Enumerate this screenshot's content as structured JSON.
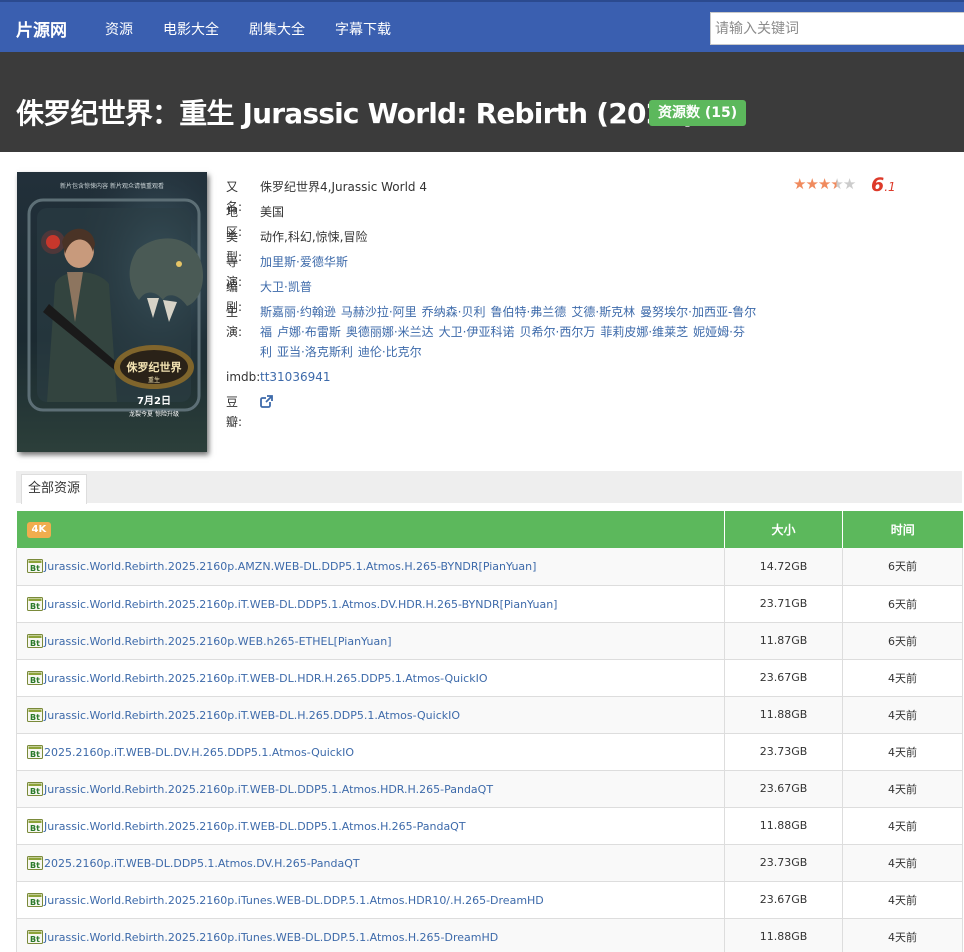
{
  "nav": {
    "brand": "片源网",
    "items": [
      "资源",
      "电影大全",
      "剧集大全",
      "字幕下载"
    ],
    "search_placeholder": "请输入关键词"
  },
  "movie": {
    "title": "侏罗纪世界：重生 Jurassic World: Rebirth (2025)",
    "resource_badge": "资源数 (15)",
    "poster": {
      "top_text": "新片包含惊悚内容  新片观众请慎重观看",
      "logo_title": "侏罗纪世界",
      "logo_sub": "重生",
      "release": "7月2日",
      "tagline": "龙裂今夏 惊险升级"
    },
    "rating": {
      "stars": 3.5,
      "score_big": "6",
      "score_small": ".1"
    },
    "labels": {
      "aka": "又名:",
      "region": "地区:",
      "genre": "类型:",
      "director": "导演:",
      "writer": "编剧:",
      "cast": "主演:",
      "imdb": "imdb:",
      "douban": "豆瓣:"
    },
    "aka": "侏罗纪世界4,Jurassic World 4",
    "region": "美国",
    "genre": "动作,科幻,惊悚,冒险",
    "director": "加里斯·爱德华斯",
    "writer": "大卫·凯普",
    "cast": [
      "斯嘉丽·约翰逊",
      "马赫沙拉·阿里",
      "乔纳森·贝利",
      "鲁伯特·弗兰德",
      "艾德·斯克林",
      "曼努埃尔·加西亚-鲁尔福",
      "卢娜·布雷斯",
      "奥德丽娜·米兰达",
      "大卫·伊亚科诺",
      "贝希尔·西尔万",
      "菲莉皮娜·维莱芝",
      "妮娅姆·芬利",
      "亚当·洛克斯利",
      "迪伦·比克尔"
    ],
    "imdb": "tt31036941"
  },
  "tabs": {
    "active": "全部资源"
  },
  "table": {
    "quality_badge": "4K",
    "col_size": "大小",
    "col_time": "时间",
    "rows": [
      {
        "name": "Jurassic.World.Rebirth.2025.2160p.AMZN.WEB-DL.DDP5.1.Atmos.H.265-BYNDR[PianYuan]",
        "size": "14.72GB",
        "time": "6天前"
      },
      {
        "name": "Jurassic.World.Rebirth.2025.2160p.iT.WEB-DL.DDP5.1.Atmos.DV.HDR.H.265-BYNDR[PianYuan]",
        "size": "23.71GB",
        "time": "6天前"
      },
      {
        "name": "Jurassic.World.Rebirth.2025.2160p.WEB.h265-ETHEL[PianYuan]",
        "size": "11.87GB",
        "time": "6天前"
      },
      {
        "name": "Jurassic.World.Rebirth.2025.2160p.iT.WEB-DL.HDR.H.265.DDP5.1.Atmos-QuickIO",
        "size": "23.67GB",
        "time": "4天前"
      },
      {
        "name": "Jurassic.World.Rebirth.2025.2160p.iT.WEB-DL.H.265.DDP5.1.Atmos-QuickIO",
        "size": "11.88GB",
        "time": "4天前"
      },
      {
        "name": "2025.2160p.iT.WEB-DL.DV.H.265.DDP5.1.Atmos-QuickIO",
        "size": "23.73GB",
        "time": "4天前"
      },
      {
        "name": "Jurassic.World.Rebirth.2025.2160p.iT.WEB-DL.DDP5.1.Atmos.HDR.H.265-PandaQT",
        "size": "23.67GB",
        "time": "4天前"
      },
      {
        "name": "Jurassic.World.Rebirth.2025.2160p.iT.WEB-DL.DDP5.1.Atmos.H.265-PandaQT",
        "size": "11.88GB",
        "time": "4天前"
      },
      {
        "name": "2025.2160p.iT.WEB-DL.DDP5.1.Atmos.DV.H.265-PandaQT",
        "size": "23.73GB",
        "time": "4天前"
      },
      {
        "name": "Jurassic.World.Rebirth.2025.2160p.iTunes.WEB-DL.DDP.5.1.Atmos.HDR10/.H.265-DreamHD",
        "size": "23.67GB",
        "time": "4天前"
      },
      {
        "name": "Jurassic.World.Rebirth.2025.2160p.iTunes.WEB-DL.DDP.5.1.Atmos.H.265-DreamHD",
        "size": "11.88GB",
        "time": "4天前"
      }
    ]
  },
  "colors": {
    "navbar": "#3a5fb0",
    "hero": "#3b3b3b",
    "accent_green": "#5cb85c",
    "badge_orange": "#f0ad4e",
    "link": "#3d6aaa",
    "rating_red": "#dd3a2a",
    "star": "#f08a5d"
  },
  "icons": {
    "torrent": "bt-torrent-icon",
    "external_link": "external-link-icon",
    "star": "star-icon"
  }
}
